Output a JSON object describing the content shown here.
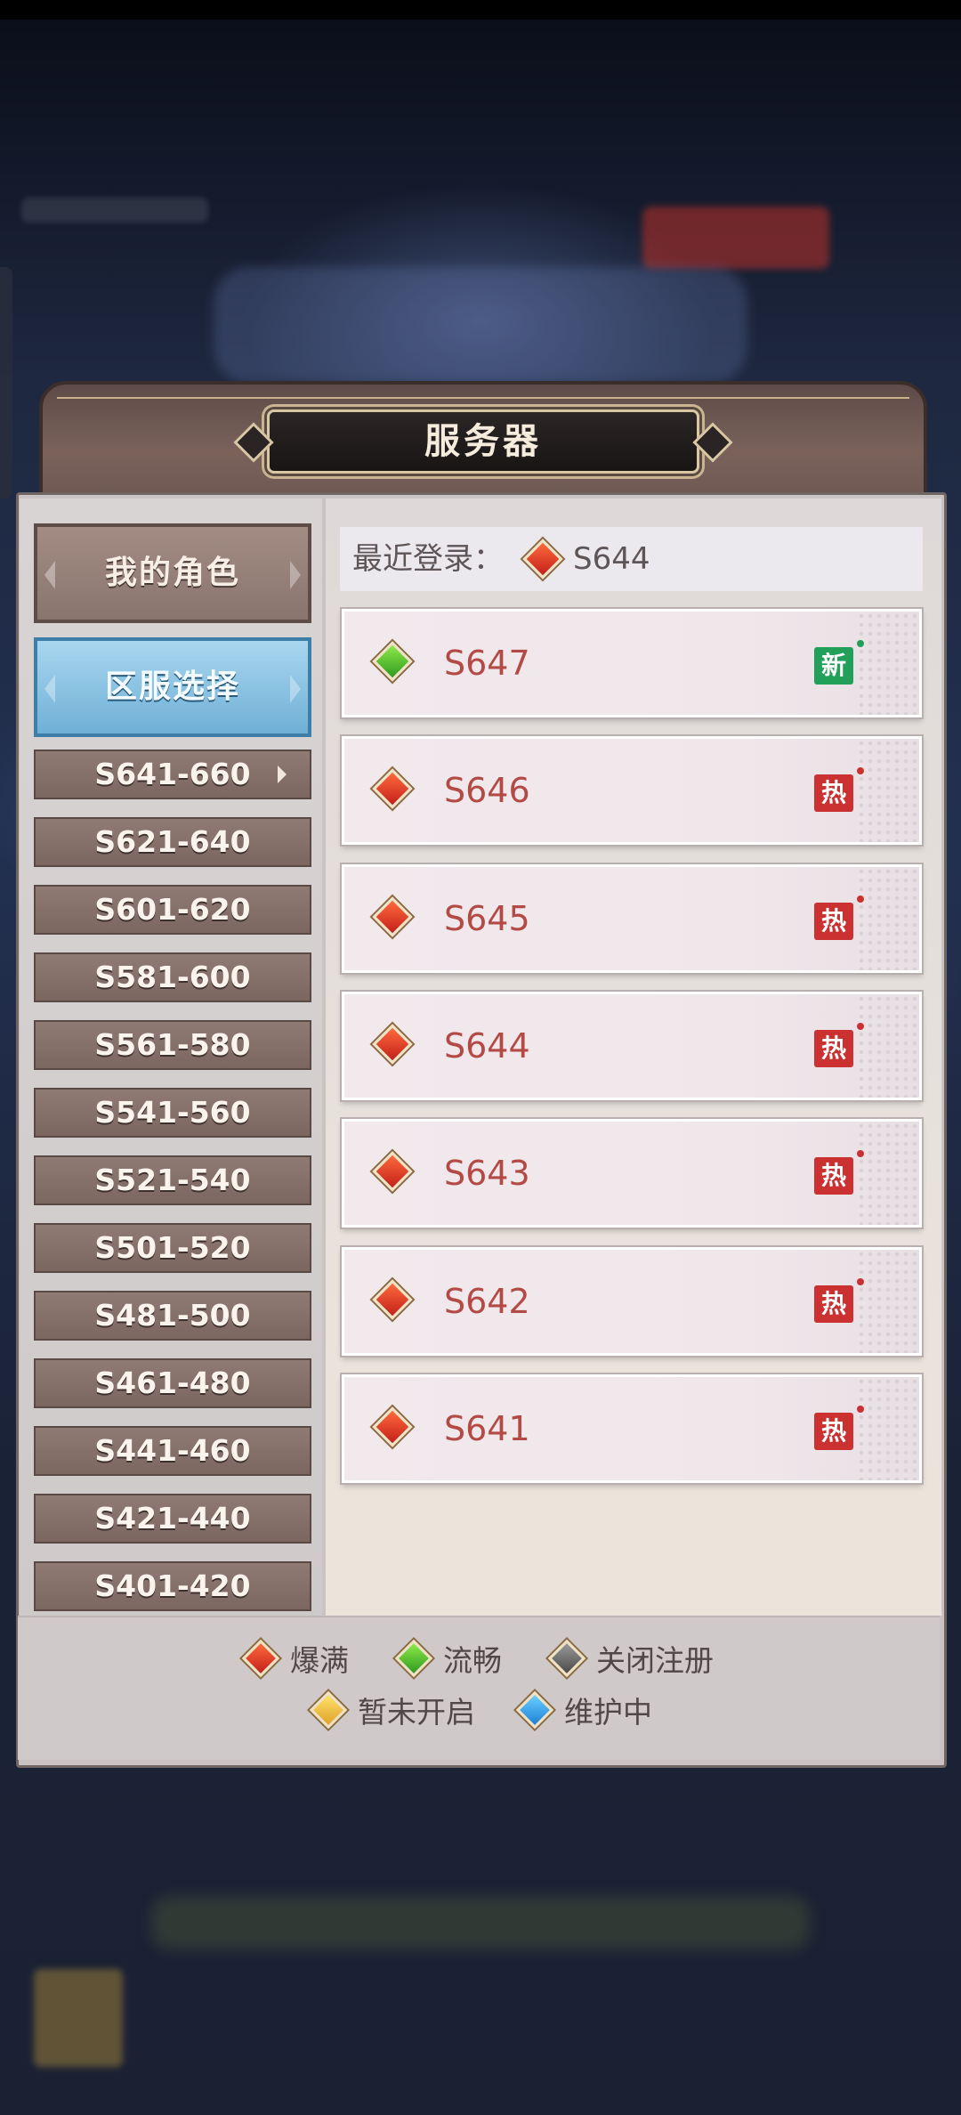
{
  "panel": {
    "title": "服务器"
  },
  "tabs": {
    "my_role": "我的角色",
    "server_select": "区服选择"
  },
  "ranges": [
    {
      "label": "S641-660",
      "active": true
    },
    {
      "label": "S621-640"
    },
    {
      "label": "S601-620"
    },
    {
      "label": "S581-600"
    },
    {
      "label": "S561-580"
    },
    {
      "label": "S541-560"
    },
    {
      "label": "S521-540"
    },
    {
      "label": "S501-520"
    },
    {
      "label": "S481-500"
    },
    {
      "label": "S461-480"
    },
    {
      "label": "S441-460"
    },
    {
      "label": "S421-440"
    },
    {
      "label": "S401-420"
    }
  ],
  "recent": {
    "label": "最近登录：",
    "server": "S644",
    "status": "red"
  },
  "servers": [
    {
      "name": "S647",
      "status": "green",
      "tag": "新"
    },
    {
      "name": "S646",
      "status": "red",
      "tag": "热"
    },
    {
      "name": "S645",
      "status": "red",
      "tag": "热"
    },
    {
      "name": "S644",
      "status": "red",
      "tag": "热"
    },
    {
      "name": "S643",
      "status": "red",
      "tag": "热"
    },
    {
      "name": "S642",
      "status": "red",
      "tag": "热"
    },
    {
      "name": "S641",
      "status": "red",
      "tag": "热"
    }
  ],
  "legend": {
    "full": "爆满",
    "smooth": "流畅",
    "closed": "关闭注册",
    "not_open": "暂未开启",
    "maintenance": "维护中"
  },
  "colors": {
    "red": "#c3201a",
    "green": "#2f9a1f",
    "gray": "#4a4a4a",
    "yellow": "#e0a12a",
    "blue": "#1c7fd6",
    "hot_badge": "#cc3131",
    "new_badge": "#22a05a"
  }
}
